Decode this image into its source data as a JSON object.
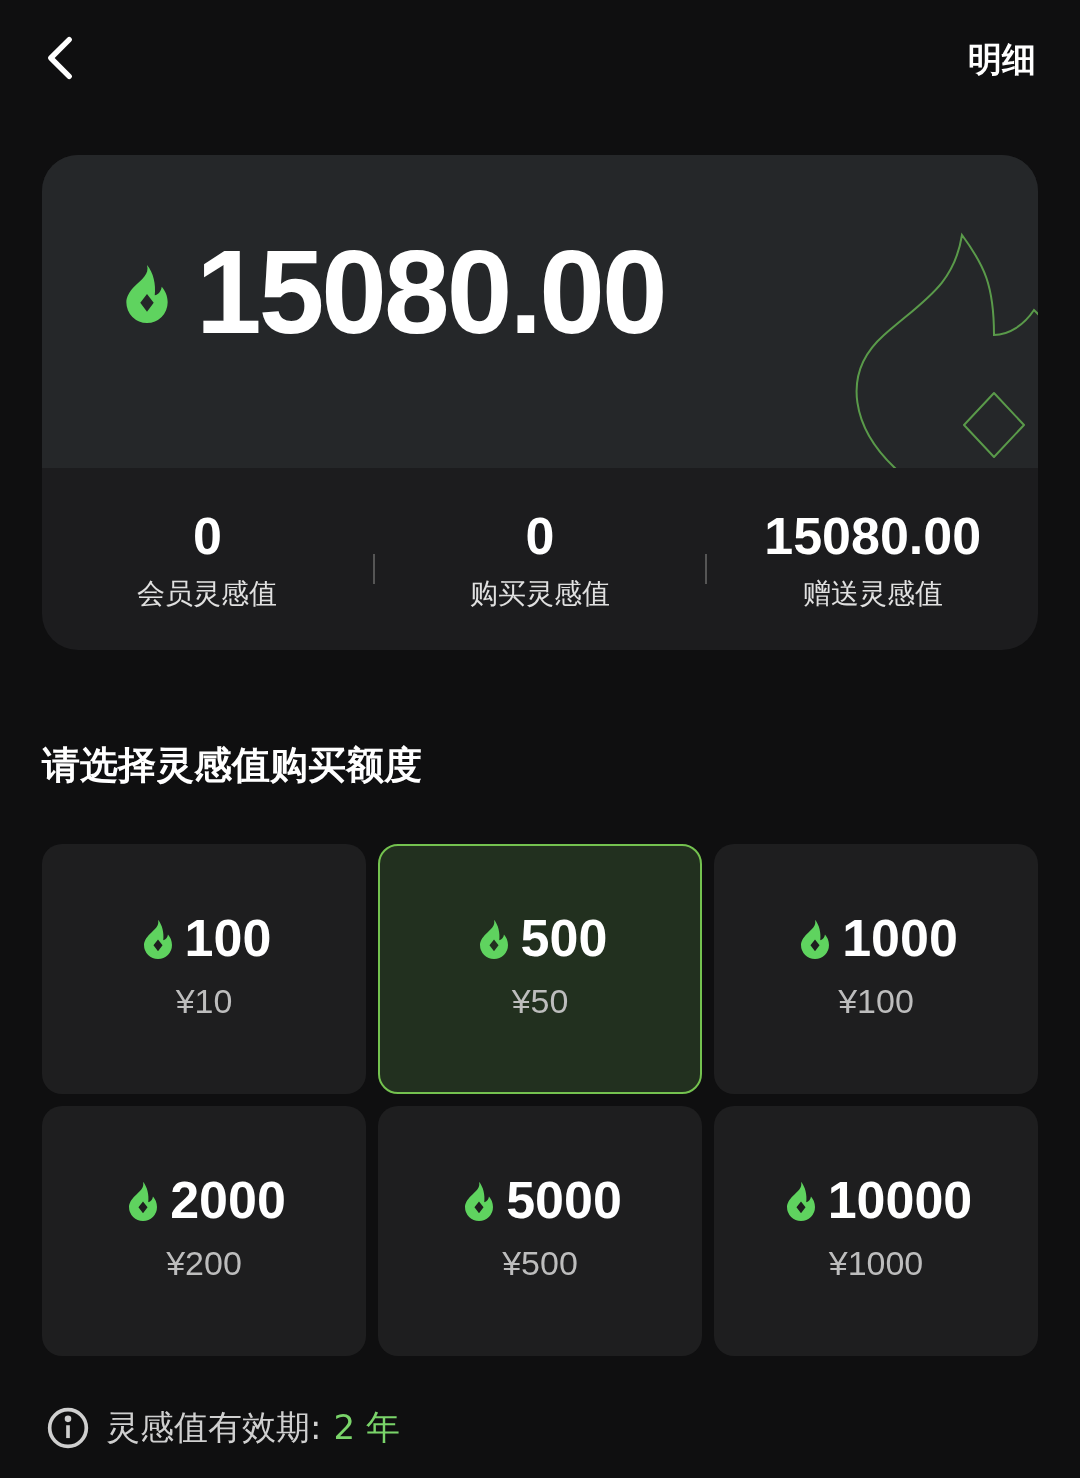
{
  "header": {
    "detail_link": "明细"
  },
  "balance": {
    "amount": "15080.00"
  },
  "stats": [
    {
      "value": "0",
      "label": "会员灵感值"
    },
    {
      "value": "0",
      "label": "购买灵感值"
    },
    {
      "value": "15080.00",
      "label": "赠送灵感值"
    }
  ],
  "section_title": "请选择灵感值购买额度",
  "options": [
    {
      "amount": "100",
      "price": "¥10",
      "selected": false
    },
    {
      "amount": "500",
      "price": "¥50",
      "selected": true
    },
    {
      "amount": "1000",
      "price": "¥100",
      "selected": false
    },
    {
      "amount": "2000",
      "price": "¥200",
      "selected": false
    },
    {
      "amount": "5000",
      "price": "¥500",
      "selected": false
    },
    {
      "amount": "10000",
      "price": "¥1000",
      "selected": false
    }
  ],
  "validity": {
    "label": "灵感值有效期:",
    "value": "2 年"
  }
}
